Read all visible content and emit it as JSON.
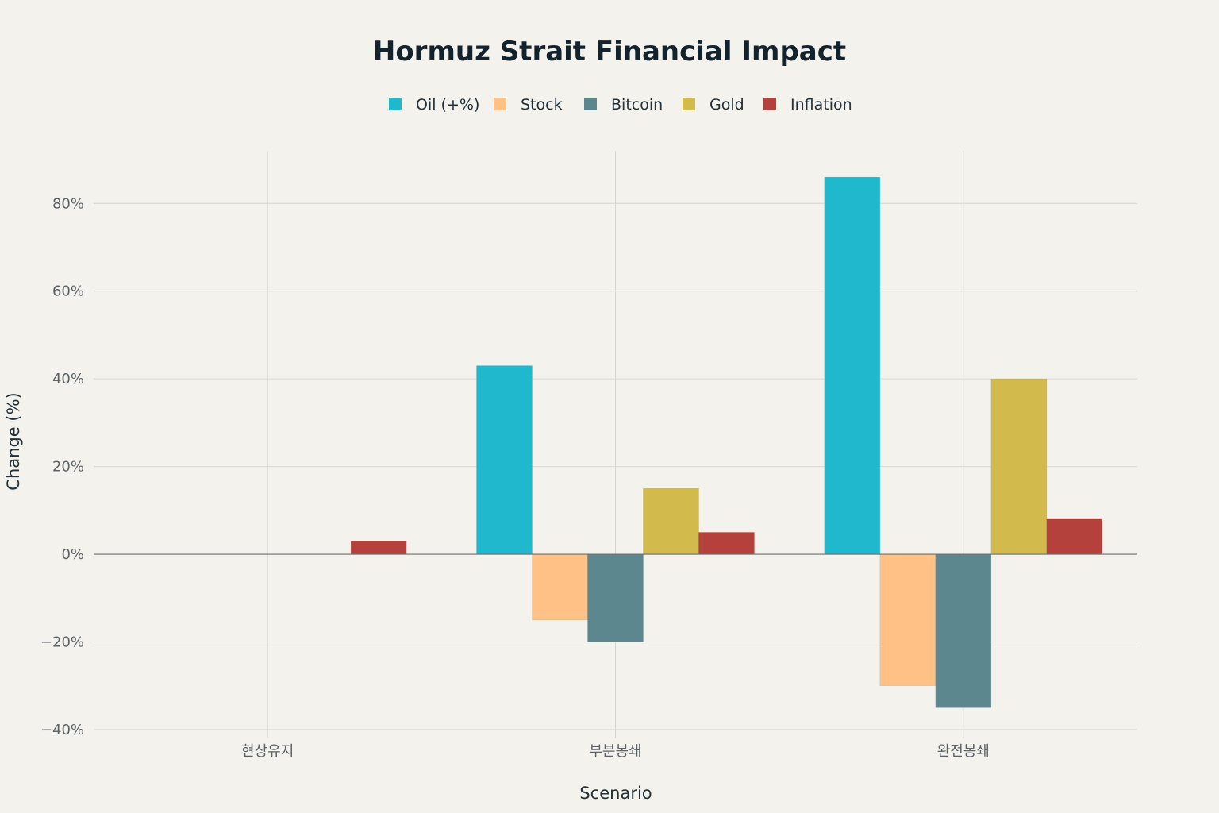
{
  "chart_data": {
    "type": "bar",
    "title": "Hormuz Strait Financial Impact",
    "xlabel": "Scenario",
    "ylabel": "Change (%)",
    "categories": [
      "현상유지",
      "부분봉쇄",
      "완전봉쇄"
    ],
    "series": [
      {
        "name": "Oil (+%)",
        "color": "#1fb8cd",
        "values": [
          0,
          43,
          86
        ]
      },
      {
        "name": "Stock",
        "color": "#ffc185",
        "values": [
          0,
          -15,
          -30
        ]
      },
      {
        "name": "Bitcoin",
        "color": "#5d878f",
        "values": [
          0,
          -20,
          -35
        ]
      },
      {
        "name": "Gold",
        "color": "#d2ba4c",
        "values": [
          0,
          15,
          40
        ]
      },
      {
        "name": "Inflation",
        "color": "#b4413c",
        "values": [
          3,
          5,
          8
        ]
      }
    ],
    "ylim": [
      -42,
      92
    ],
    "yticks": [
      -40,
      -20,
      0,
      20,
      40,
      60,
      80
    ],
    "ytick_labels": [
      "−40%",
      "−20%",
      "0%",
      "20%",
      "40%",
      "60%",
      "80%"
    ],
    "grid": true,
    "legend_position": "top-center"
  }
}
